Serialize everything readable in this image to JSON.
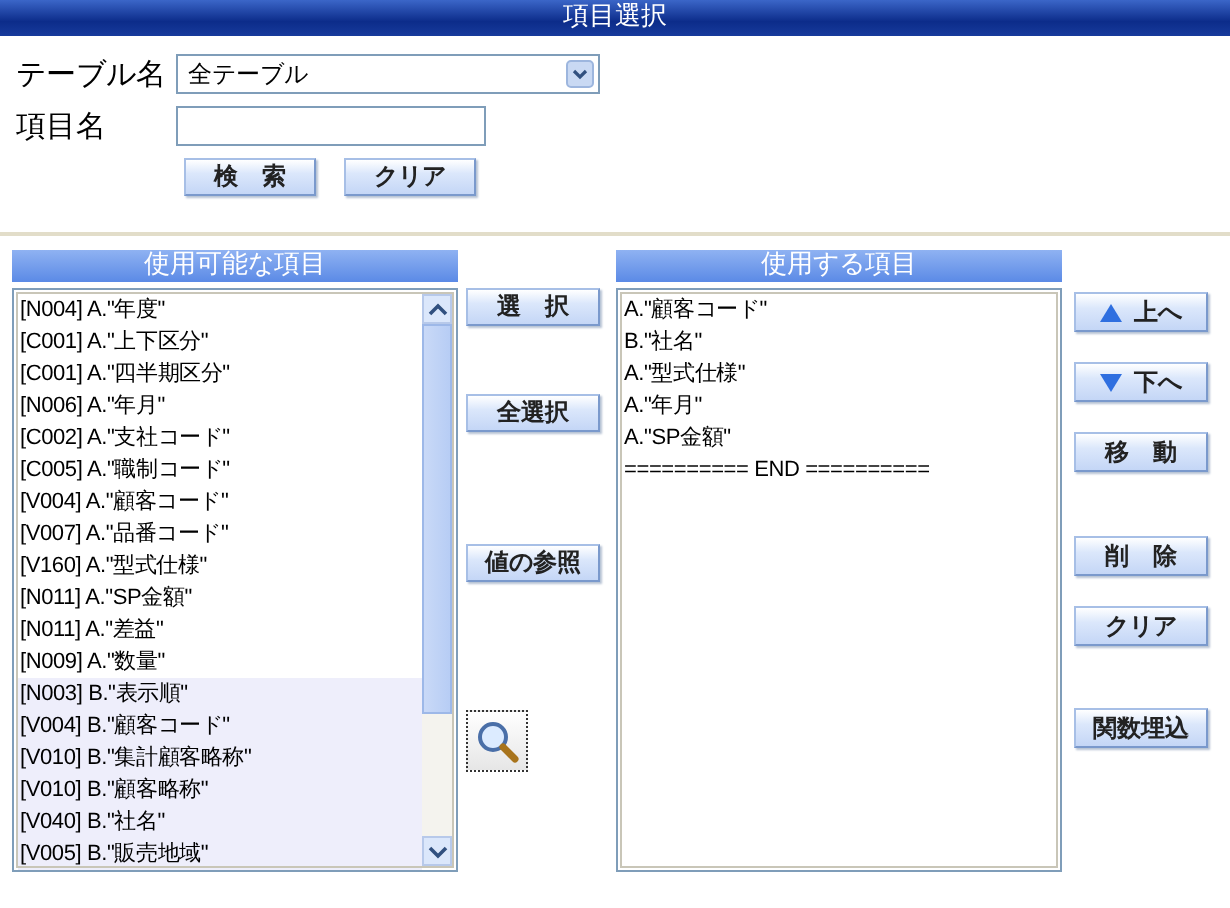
{
  "window": {
    "title": "項目選択"
  },
  "search": {
    "table_label": "テーブル名",
    "table_value": "全テーブル",
    "item_label": "項目名",
    "buttons": [
      "検　索",
      "クリア"
    ]
  },
  "available": {
    "title": "使用可能な項目",
    "items": [
      {
        "text": "[N004] A.\"年度\"",
        "highlighted": false
      },
      {
        "text": "[C001] A.\"上下区分\"",
        "highlighted": false
      },
      {
        "text": "[C001] A.\"四半期区分\"",
        "highlighted": false
      },
      {
        "text": "[N006] A.\"年月\"",
        "highlighted": false
      },
      {
        "text": "[C002] A.\"支社コード\"",
        "highlighted": false
      },
      {
        "text": "[C005] A.\"職制コード\"",
        "highlighted": false
      },
      {
        "text": "[V004] A.\"顧客コード\"",
        "highlighted": false
      },
      {
        "text": "[V007] A.\"品番コード\"",
        "highlighted": false
      },
      {
        "text": "[V160] A.\"型式仕様\"",
        "highlighted": false
      },
      {
        "text": "[N011] A.\"SP金額\"",
        "highlighted": false
      },
      {
        "text": "[N011] A.\"差益\"",
        "highlighted": false
      },
      {
        "text": "[N009] A.\"数量\"",
        "highlighted": false
      },
      {
        "text": "[N003] B.\"表示順\"",
        "highlighted": true
      },
      {
        "text": "[V004] B.\"顧客コード\"",
        "highlighted": true
      },
      {
        "text": "[V010] B.\"集計顧客略称\"",
        "highlighted": true
      },
      {
        "text": "[V010] B.\"顧客略称\"",
        "highlighted": true
      },
      {
        "text": "[V040] B.\"社名\"",
        "highlighted": true
      },
      {
        "text": "[V005] B.\"販売地域\"",
        "highlighted": true
      }
    ]
  },
  "middle_buttons": [
    {
      "label": "選　択",
      "kind": "text"
    },
    {
      "label": "全選択",
      "kind": "text"
    },
    {
      "label": "値の参照",
      "kind": "text"
    },
    {
      "kind": "magnifier"
    }
  ],
  "used": {
    "title": "使用する項目",
    "items": [
      "A.\"顧客コード\"",
      "B.\"社名\"",
      "A.\"型式仕様\"",
      "A.\"年月\"",
      "A.\"SP金額\"",
      "========== END =========="
    ]
  },
  "right_buttons": [
    {
      "label": "上へ",
      "kind": "up"
    },
    {
      "label": "下へ",
      "kind": "down"
    },
    {
      "label": "移　動",
      "kind": "text"
    },
    {
      "label": "削　除",
      "kind": "text"
    },
    {
      "label": "クリア",
      "kind": "text"
    },
    {
      "label": "関数埋込",
      "kind": "text"
    }
  ]
}
